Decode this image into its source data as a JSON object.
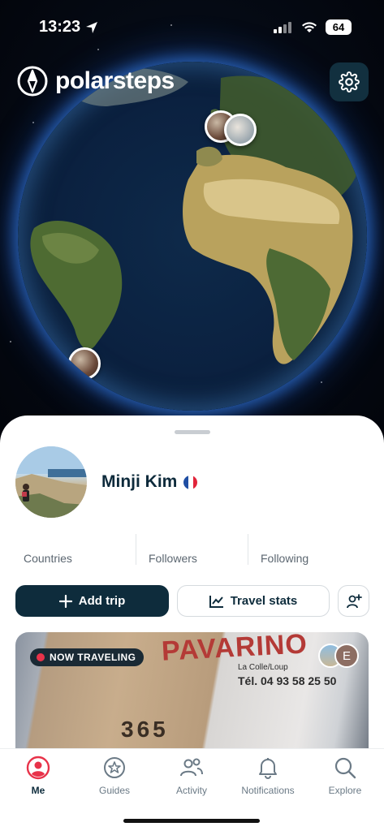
{
  "status_bar": {
    "time": "13:23",
    "battery": "64",
    "location_icon": "location-arrow-icon",
    "signal_icon": "cell-signal-icon",
    "wifi_icon": "wifi-icon"
  },
  "app": {
    "name": "polarsteps",
    "logo_icon": "compass-icon",
    "settings_icon": "gear-icon"
  },
  "profile": {
    "name": "Minji Kim",
    "flag": "France",
    "stats": [
      {
        "label": "Countries",
        "value": ""
      },
      {
        "label": "Followers",
        "value": ""
      },
      {
        "label": "Following",
        "value": ""
      }
    ]
  },
  "actions": {
    "add_trip": "Add trip",
    "travel_stats": "Travel stats",
    "add_friend_icon": "add-person-icon"
  },
  "trip_card": {
    "badge": "NOW TRAVELING",
    "photo_text": "PAVARINO",
    "photo_sub": "La Colle/Loup",
    "photo_phone": "Tél. 04 93 58 25 50",
    "photo_number": "365",
    "companion_initial": "E"
  },
  "tabs": [
    {
      "label": "Me",
      "icon": "user-circle-icon",
      "active": true
    },
    {
      "label": "Guides",
      "icon": "star-badge-icon",
      "active": false
    },
    {
      "label": "Activity",
      "icon": "people-icon",
      "active": false
    },
    {
      "label": "Notifications",
      "icon": "bell-icon",
      "active": false
    },
    {
      "label": "Explore",
      "icon": "search-icon",
      "active": false
    }
  ],
  "colors": {
    "primary": "#0e2c3c",
    "accent_red": "#e8334a",
    "globe_glow": "#3c8cff"
  }
}
